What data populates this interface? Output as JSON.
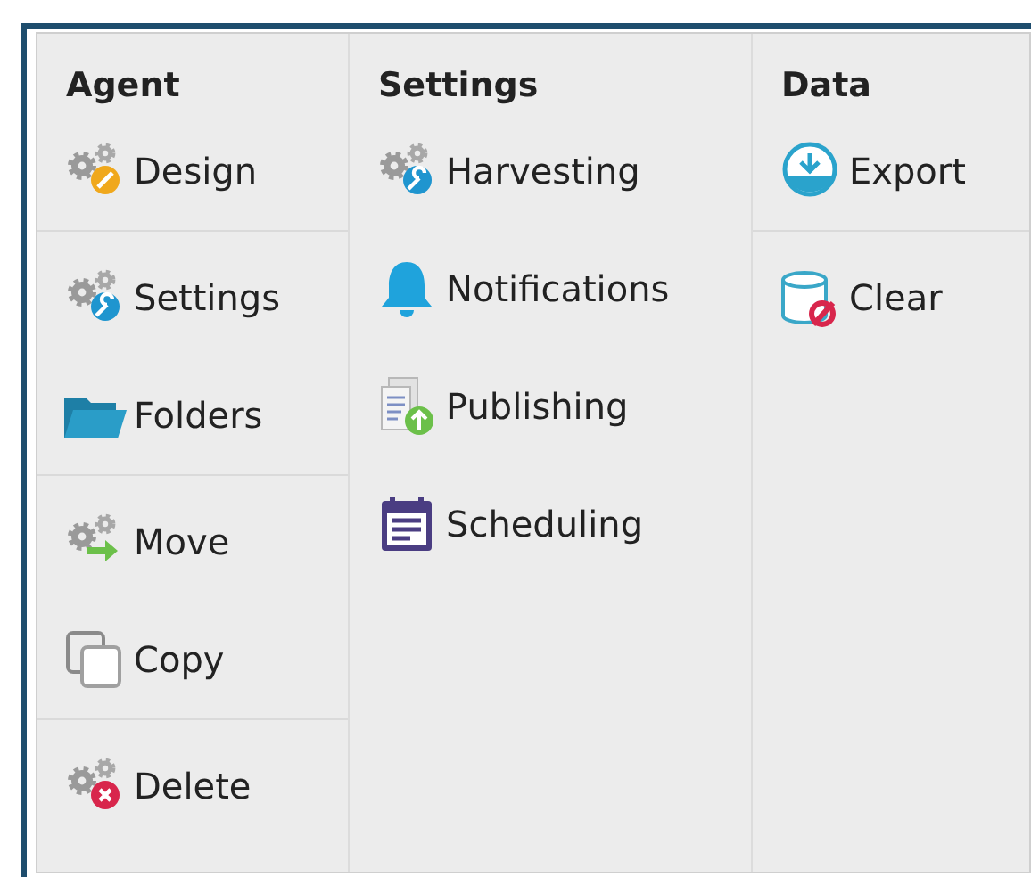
{
  "columns": [
    {
      "title": "Agent",
      "groups": [
        [
          {
            "label": "Design",
            "kind": "gear-pencil"
          }
        ],
        [
          {
            "label": "Settings",
            "kind": "gear-wrench"
          },
          {
            "label": "Folders",
            "kind": "folder"
          }
        ],
        [
          {
            "label": "Move",
            "kind": "gear-arrow"
          },
          {
            "label": "Copy",
            "kind": "copy"
          }
        ],
        [
          {
            "label": "Delete",
            "kind": "gear-delete"
          }
        ]
      ]
    },
    {
      "title": "Settings",
      "groups": [
        [
          {
            "label": "Harvesting",
            "kind": "gear-wrench"
          },
          {
            "label": "Notifications",
            "kind": "bell"
          },
          {
            "label": "Publishing",
            "kind": "publish"
          },
          {
            "label": "Scheduling",
            "kind": "calendar"
          }
        ]
      ]
    },
    {
      "title": "Data",
      "groups": [
        [
          {
            "label": "Export",
            "kind": "export"
          }
        ],
        [
          {
            "label": "Clear",
            "kind": "clear"
          }
        ]
      ]
    }
  ]
}
